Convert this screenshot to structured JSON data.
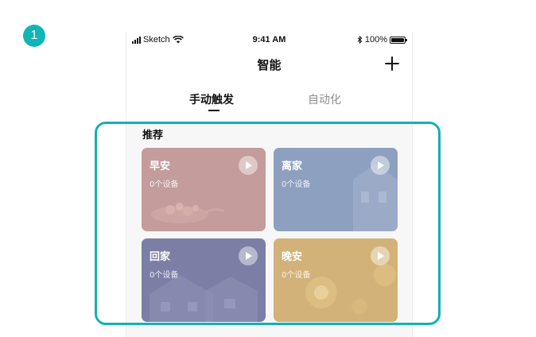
{
  "step_badge": "1",
  "status_bar": {
    "carrier": "Sketch",
    "time": "9:41 AM",
    "battery": "100%"
  },
  "nav": {
    "title": "智能",
    "add_icon": "plus-icon"
  },
  "tabs": [
    {
      "label": "手动触发",
      "active": true
    },
    {
      "label": "自动化",
      "active": false
    }
  ],
  "section": {
    "title": "推荐"
  },
  "scenes": [
    {
      "name": "早安",
      "devices": "0个设备",
      "color": "#c39c9b"
    },
    {
      "name": "离家",
      "devices": "0个设备",
      "color": "#8ea0bf"
    },
    {
      "name": "回家",
      "devices": "0个设备",
      "color": "#7b7fa5"
    },
    {
      "name": "晚安",
      "devices": "0个设备",
      "color": "#d2b278"
    }
  ],
  "colors": {
    "highlight": "#15b0b3",
    "badge": "#10b6b6"
  }
}
